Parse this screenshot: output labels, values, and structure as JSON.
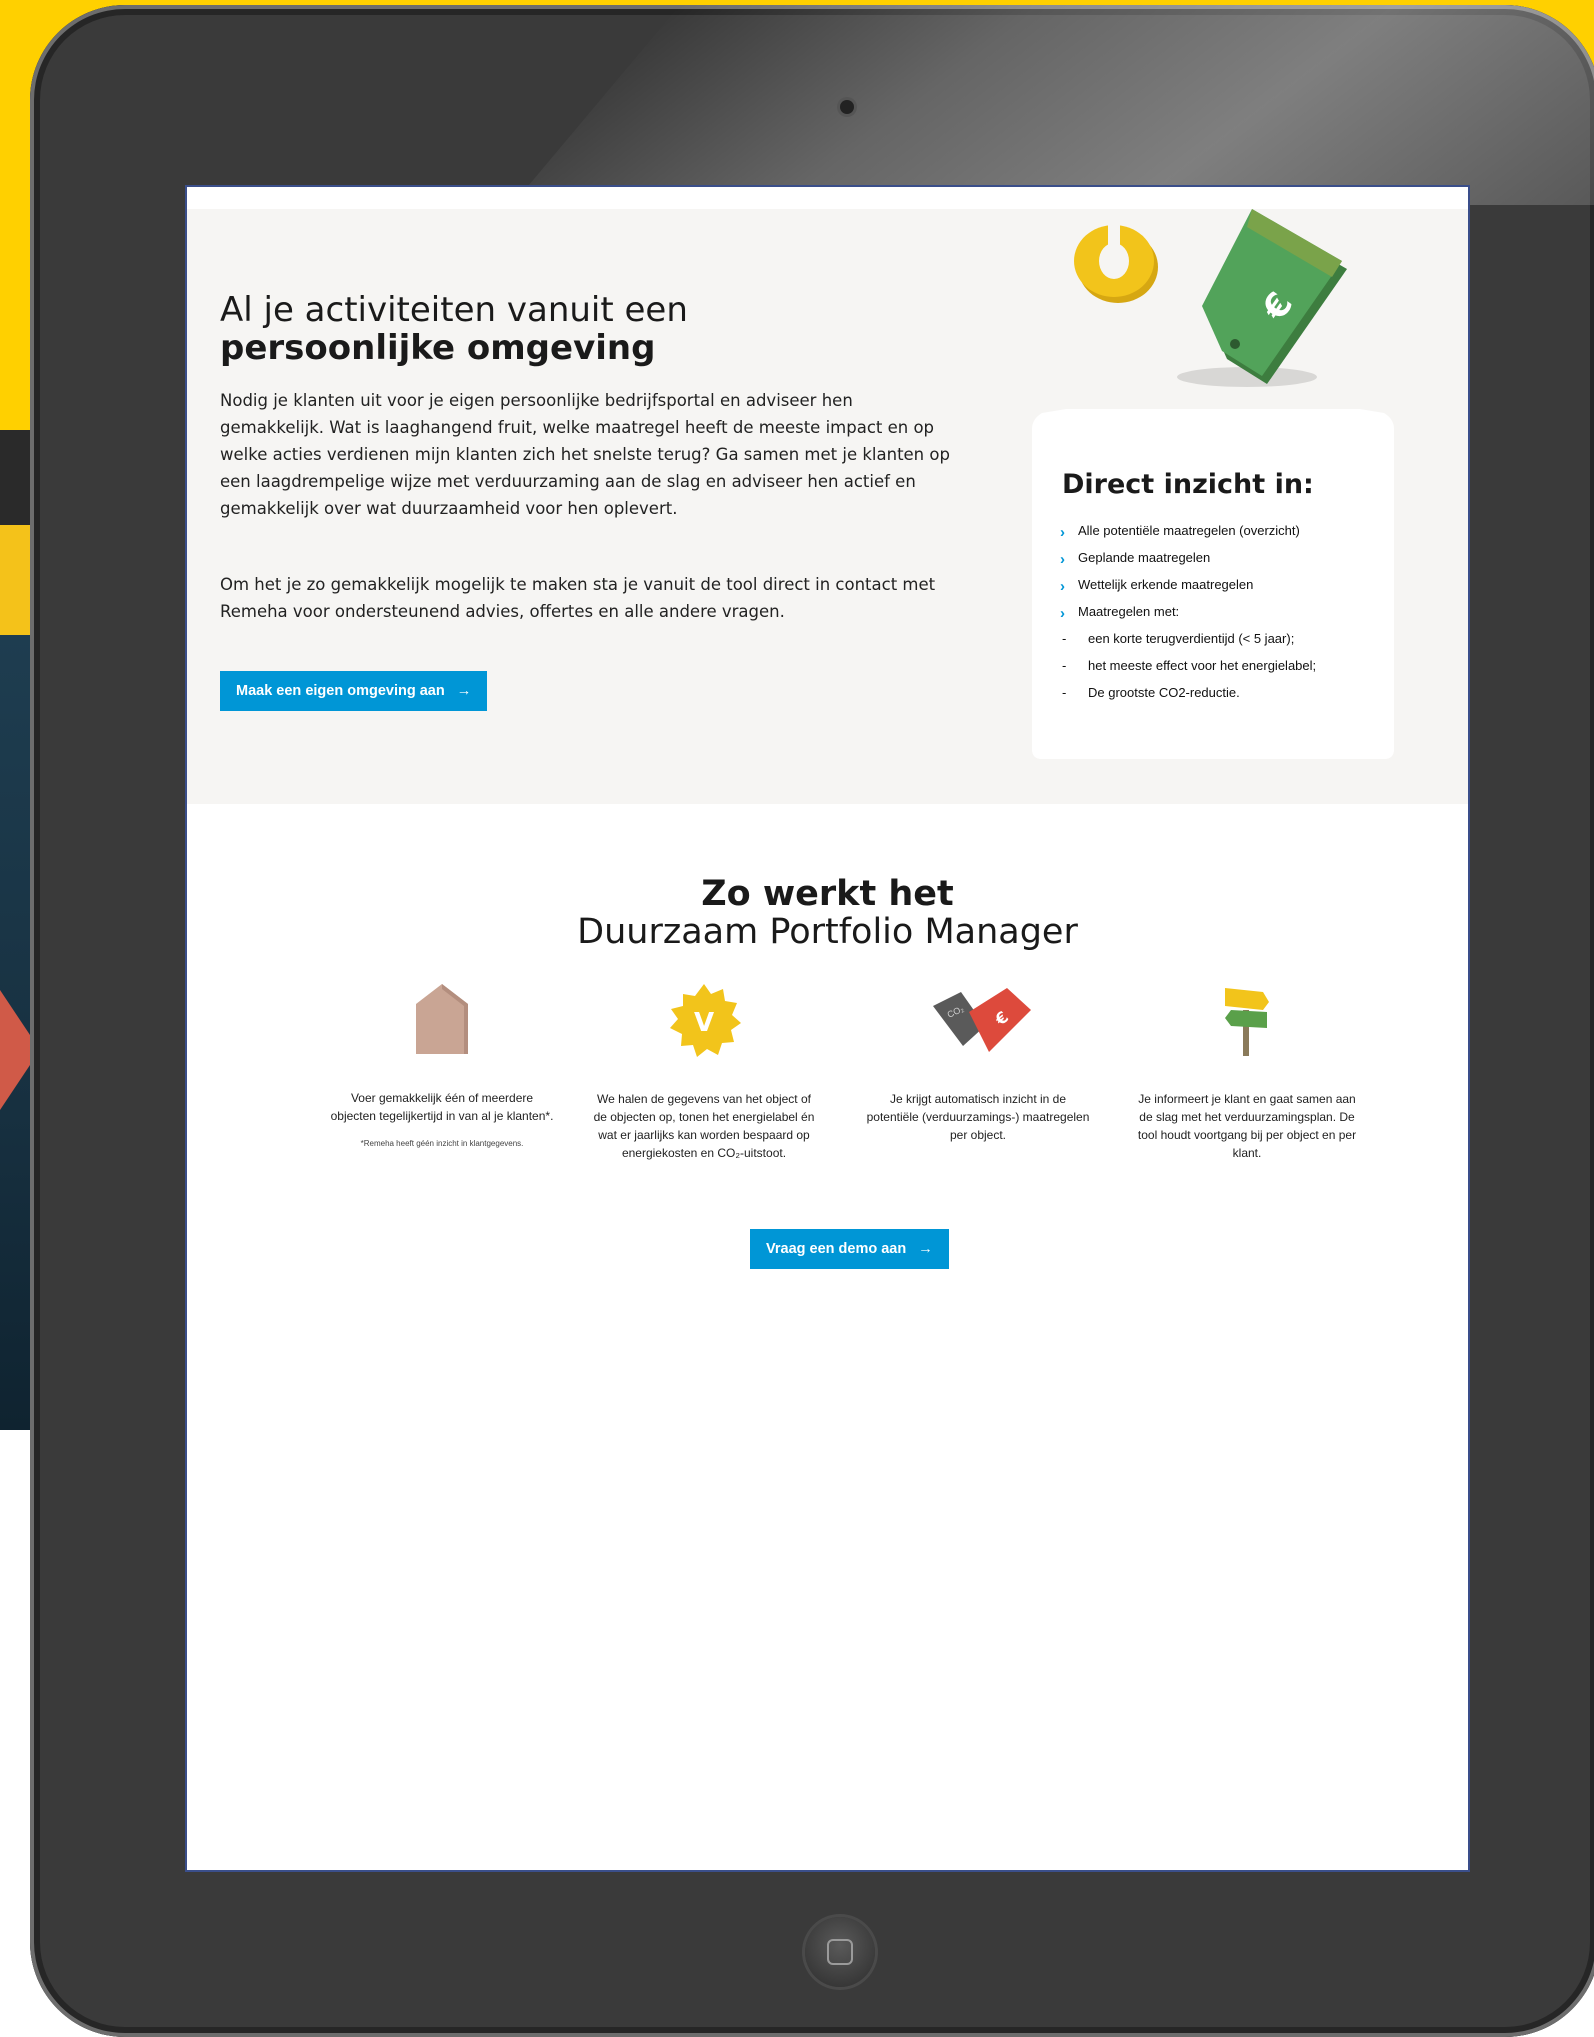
{
  "hero": {
    "title_line1": "Al je activiteiten vanuit een",
    "title_line2": "persoonlijke omgeving",
    "paragraph1": "Nodig je klanten uit voor je eigen persoonlijke bedrijfsportal en adviseer hen gemakkelijk. Wat is laaghangend fruit, welke maatregel heeft de meeste impact en op welke acties verdienen mijn klanten zich het snelste terug? Ga samen met je klanten op een laagdrempelige wijze met verduurzaming aan de slag en adviseer hen actief en gemakkelijk over wat duurzaamheid voor hen oplevert.",
    "paragraph2": "Om het je zo gemakkelijk mogelijk te maken sta je vanuit de tool direct in contact met Remeha voor ondersteunend advies, offertes en alle andere vragen.",
    "button_label": "Maak een eigen omgeving aan",
    "button_arrow": "→"
  },
  "card": {
    "title": "Direct inzicht in:",
    "items": [
      "Alle potentiële maatregelen (overzicht)",
      "Geplande maatregelen",
      "Wettelijk erkende maatregelen",
      "Maatregelen met:"
    ],
    "subitems": [
      "een korte terugverdientijd (< 5 jaar);",
      "het meeste effect voor het energielabel;",
      "De grootste CO2-reductie."
    ],
    "bullet": "›",
    "dash": "-"
  },
  "how": {
    "title_line1": "Zo werkt het",
    "title_line2": "Duurzaam Portfolio Manager",
    "steps": [
      {
        "icon": "house-icon",
        "text": "Voer gemakkelijk één of meerdere objecten tegelijkertijd in van al je klanten*.",
        "note": "*Remeha heeft géén inzicht in klantgegevens."
      },
      {
        "icon": "check-badge-icon",
        "text": "We halen de gegevens van het object of de objecten op, tonen het energielabel én wat er jaarlijks kan worden bespaard op energiekosten en CO₂-uitstoot."
      },
      {
        "icon": "price-tags-icon",
        "text": "Je krijgt automatisch inzicht in de potentiële (verduurzamings-) maatregelen per object."
      },
      {
        "icon": "signpost-icon",
        "text": "Je informeert je klant en gaat samen aan de slag met het verduurzamingsplan. De tool houdt voortgang bij per object en per klant."
      }
    ],
    "button_label": "Vraag een demo aan",
    "button_arrow": "→"
  },
  "icons": {
    "check_letter": "V",
    "co2_label": "CO₂",
    "tag_symbol": "€",
    "coin_icon": "coin-icon",
    "tag_icon": "price-tag-icon"
  },
  "colors": {
    "accent": "#0096d6",
    "background_yellow": "#ffd000",
    "hero_bg": "#f6f5f3",
    "tag_green": "#4a9a4e",
    "coin_yellow": "#f2c41b"
  }
}
